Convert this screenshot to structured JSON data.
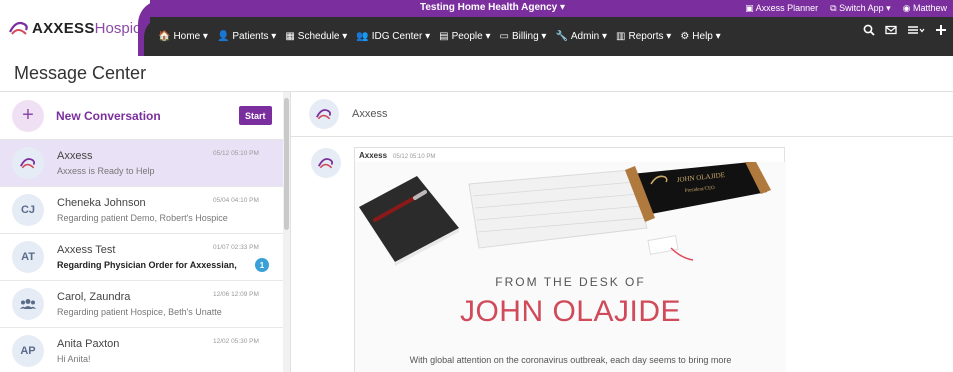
{
  "brand": {
    "axxess": "AXXESS",
    "hospice": "Hospice"
  },
  "topbar": {
    "agency": "Testing Home Health Agency ▾",
    "planner": "Axxess Planner",
    "switch_app": "Switch App ▾",
    "user": "Matthew"
  },
  "nav": [
    {
      "label": "Home ▾",
      "icon": "home-icon",
      "glyph": "🏠"
    },
    {
      "label": "Patients ▾",
      "icon": "user-icon",
      "glyph": "👤"
    },
    {
      "label": "Schedule ▾",
      "icon": "calendar-icon",
      "glyph": "▦"
    },
    {
      "label": "IDG Center ▾",
      "icon": "group-icon",
      "glyph": "👥"
    },
    {
      "label": "People ▾",
      "icon": "id-card-icon",
      "glyph": "▤"
    },
    {
      "label": "Billing ▾",
      "icon": "billing-icon",
      "glyph": "▭"
    },
    {
      "label": "Admin ▾",
      "icon": "wrench-icon",
      "glyph": "🔧"
    },
    {
      "label": "Reports ▾",
      "icon": "bar-chart-icon",
      "glyph": "▥"
    },
    {
      "label": "Help ▾",
      "icon": "help-icon",
      "glyph": "⚙"
    }
  ],
  "page": {
    "title": "Message Center"
  },
  "sidebar": {
    "new_conversation": "New Conversation",
    "start": "Start",
    "conversations": [
      {
        "initials": "",
        "name": "Axxess",
        "preview": "Axxess is Ready to Help",
        "time": "05/12 05:10 PM",
        "selected": true,
        "unread": false
      },
      {
        "initials": "CJ",
        "name": "Cheneka Johnson",
        "preview": "Regarding patient Demo, Robert's Hospice",
        "time": "05/04 04:10 PM",
        "selected": false,
        "unread": false
      },
      {
        "initials": "AT",
        "name": "Axxess Test",
        "preview": "Regarding Physician Order for Axxessian,",
        "time": "01/07 02:33 PM",
        "selected": false,
        "unread": true,
        "badge": "1"
      },
      {
        "initials": "",
        "name": "Carol, Zaundra",
        "preview": "Regarding patient Hospice, Beth's Unatte",
        "time": "12/06 12:09 PM",
        "selected": false,
        "unread": false
      },
      {
        "initials": "AP",
        "name": "Anita Paxton",
        "preview": "Hi Anita!",
        "time": "12/02 05:30 PM",
        "selected": false,
        "unread": false
      }
    ]
  },
  "main": {
    "header_title": "Axxess",
    "message": {
      "sender": "Axxess",
      "time": "05/12 05:10 PM",
      "caption": "FROM THE DESK OF",
      "name": "JOHN OLAJIDE",
      "plaque_line1": "JOHN OLAJIDE",
      "plaque_line2": "President/CEO",
      "body": "With global attention on the coronavirus outbreak, each day seems to bring more"
    }
  },
  "colors": {
    "brand_purple": "#7b2f9e",
    "nav_dark": "#2e2e2e",
    "accent_red": "#d04a5a",
    "badge_blue": "#3aa0d8"
  }
}
